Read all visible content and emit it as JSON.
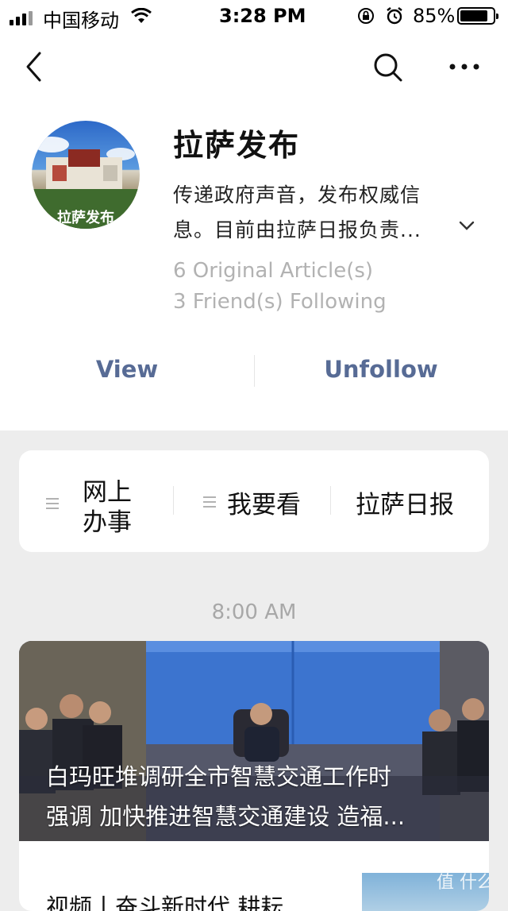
{
  "status_bar": {
    "carrier": "中国移动",
    "time": "3:28 PM",
    "battery_percent": "85%",
    "battery_level": 0.85
  },
  "nav": {
    "back_icon": "chevron-left-icon",
    "search_icon": "search-icon",
    "more_icon": "ellipsis-icon"
  },
  "profile": {
    "name": "拉萨发布",
    "avatar_caption": "拉萨发布",
    "description_line1": "传递政府声音，发布权威信",
    "description_line2": "息。目前由拉萨日报负责...",
    "original_articles": "6 Original Article(s)",
    "friends_following": "3 Friend(s) Following",
    "view_label": "View",
    "unfollow_label": "Unfollow"
  },
  "menu": {
    "items": [
      {
        "line1": "网上",
        "line2": "办事"
      },
      {
        "label": "我要看"
      },
      {
        "label": "拉萨日报"
      }
    ]
  },
  "feed": {
    "time": "8:00 AM",
    "lead_article": {
      "title_line1": "白玛旺堆调研全市智慧交通工作时",
      "title_line2": "强调 加快推进智慧交通建设 造福..."
    },
    "second_article": {
      "title": "视频丨奋斗新时代 耕耘"
    }
  },
  "watermark": {
    "text": "值 什么值得买"
  },
  "colors": {
    "link": "#576b95",
    "secondary_text": "#b2b2b2",
    "background": "#ededed"
  }
}
